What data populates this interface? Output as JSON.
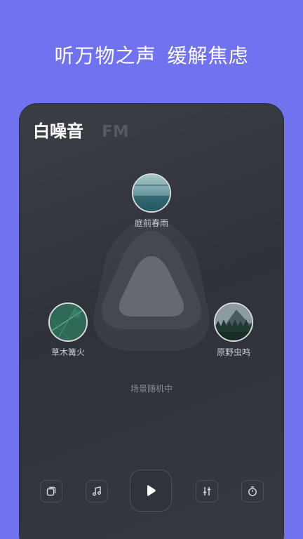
{
  "banner": {
    "headline": "听万物之声  缓解焦虑"
  },
  "tabs": [
    {
      "label": "白噪音",
      "active": true
    },
    {
      "label": "FM",
      "active": false
    }
  ],
  "scenes": [
    {
      "label": "庭前春雨",
      "icon": "lake-photo"
    },
    {
      "label": "草木篝火",
      "icon": "leaf-photo"
    },
    {
      "label": "原野虫鸣",
      "icon": "forest-photo"
    }
  ],
  "status": {
    "text": "场景随机中"
  },
  "controls": {
    "left": [
      "layers-icon",
      "music-note-icon"
    ],
    "center": "play-icon",
    "right": [
      "equalizer-icon",
      "timer-icon"
    ]
  },
  "colors": {
    "background": "#7072ef",
    "panel": "#34383f",
    "accent_text": "#ffffff",
    "inactive_tab": "#555a62"
  }
}
